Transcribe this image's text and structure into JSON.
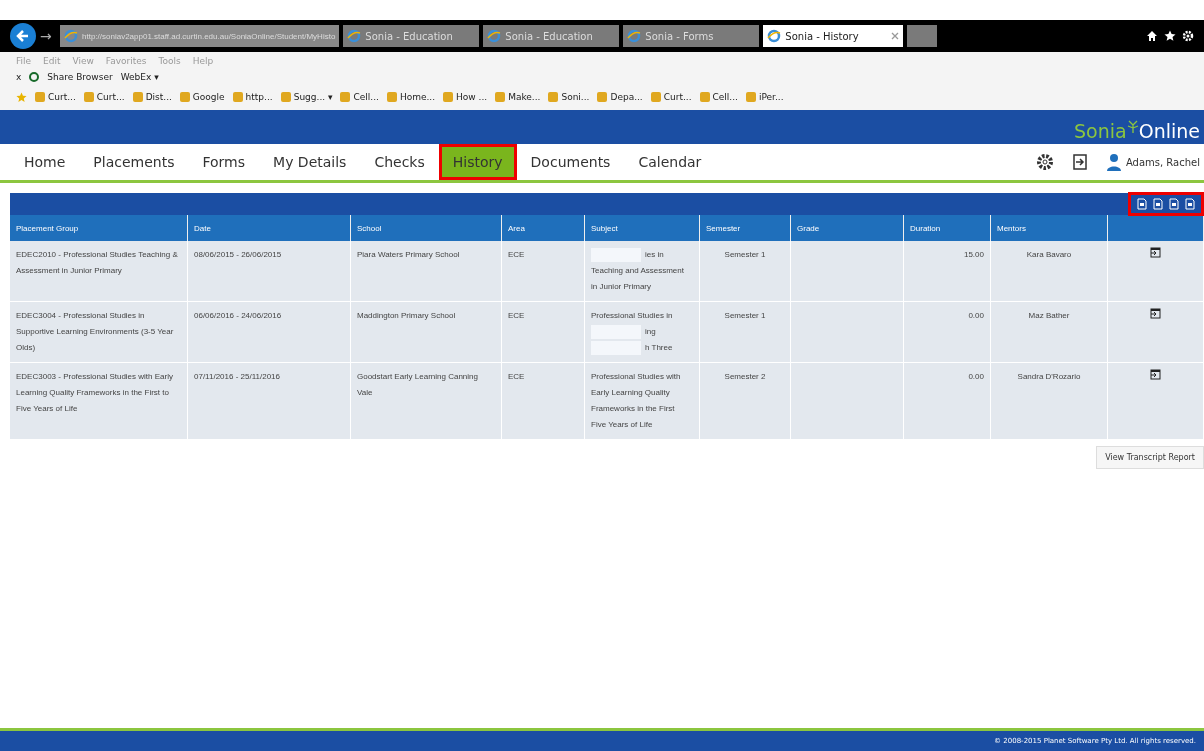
{
  "browser": {
    "forward": "→",
    "address": "http://soniav2app01.staff.ad.curtin.edu.au/SoniaOnline/Student/MyHisto",
    "tabs": [
      {
        "label": "Sonia - Education",
        "selected": false
      },
      {
        "label": "Sonia - Education",
        "selected": false
      },
      {
        "label": "Sonia - Forms",
        "selected": false
      },
      {
        "label": "Sonia - History",
        "selected": true
      }
    ],
    "menu": [
      "File",
      "Edit",
      "View",
      "Favorites",
      "Tools",
      "Help"
    ],
    "toolbar": {
      "close": "x",
      "share": "Share Browser",
      "webex": "WebEx ▾"
    },
    "favorites": [
      "Curt...",
      "Curt...",
      "Dist...",
      "Google",
      "http...",
      "Sugg... ▾",
      "Cell...",
      "Home...",
      "How ...",
      "Make...",
      "Soni...",
      "Depa...",
      "Curt...",
      "Cell...",
      "iPer..."
    ]
  },
  "logo": {
    "part1": "Sonia",
    "part2": "Online"
  },
  "nav": [
    {
      "label": "Home",
      "selected": false,
      "highlighted": false
    },
    {
      "label": "Placements",
      "selected": false,
      "highlighted": false
    },
    {
      "label": "Forms",
      "selected": false,
      "highlighted": false
    },
    {
      "label": "My Details",
      "selected": false,
      "highlighted": false
    },
    {
      "label": "Checks",
      "selected": false,
      "highlighted": false
    },
    {
      "label": "History",
      "selected": true,
      "highlighted": true
    },
    {
      "label": "Documents",
      "selected": false,
      "highlighted": false
    },
    {
      "label": "Calendar",
      "selected": false,
      "highlighted": false
    }
  ],
  "user": "Adams, Rachel",
  "export_icons_highlighted": true,
  "table": {
    "columns": [
      "Placement Group",
      "Date",
      "School",
      "Area",
      "Subject",
      "Semester",
      "Grade",
      "Duration",
      "Mentors"
    ],
    "rows": [
      {
        "group": "EDEC2010 - Professional Studies Teaching & Assessment in Junior Primary",
        "date": "08/06/2015 - 26/06/2015",
        "school": "Piara Waters Primary School",
        "area": "ECE",
        "subject": [
          {
            "text": "ies in",
            "partial": true
          },
          {
            "text": "Teaching and Assessment",
            "partial": false
          },
          {
            "text": "in Junior Primary",
            "partial": false
          }
        ],
        "semester": "Semester 1",
        "duration": "15.00",
        "mentors": "Kara Bavaro"
      },
      {
        "group": "EDEC3004 - Professional Studies in Supportive Learning Environments (3-5 Year Olds)",
        "date": "06/06/2016 - 24/06/2016",
        "school": "Maddington Primary School",
        "area": "ECE",
        "subject": [
          {
            "text": "Professional Studies in",
            "partial": false
          },
          {
            "text": "ing",
            "partial": true
          },
          {
            "text": "h Three",
            "partial": true
          }
        ],
        "semester": "Semester 1",
        "duration": "0.00",
        "mentors": "Maz Bather"
      },
      {
        "group": "EDEC3003 - Professional Studies with Early Learning Quality Frameworks in the First to Five Years of Life",
        "date": "07/11/2016 - 25/11/2016",
        "school": "Goodstart Early Learning Canning Vale",
        "area": "ECE",
        "subject": [
          {
            "text": "Professional Studies with",
            "partial": false
          },
          {
            "text": "Early Learning Quality",
            "partial": false
          },
          {
            "text": "Frameworks in the First",
            "partial": false
          },
          {
            "text": "Five Years of Life",
            "partial": false
          }
        ],
        "semester": "Semester 2",
        "duration": "0.00",
        "mentors": "Sandra D'Rozario"
      }
    ]
  },
  "transcript_button": "View Transcript Report",
  "footer": "© 2008-2015 Planet Software Pty Ltd. All rights reserved."
}
